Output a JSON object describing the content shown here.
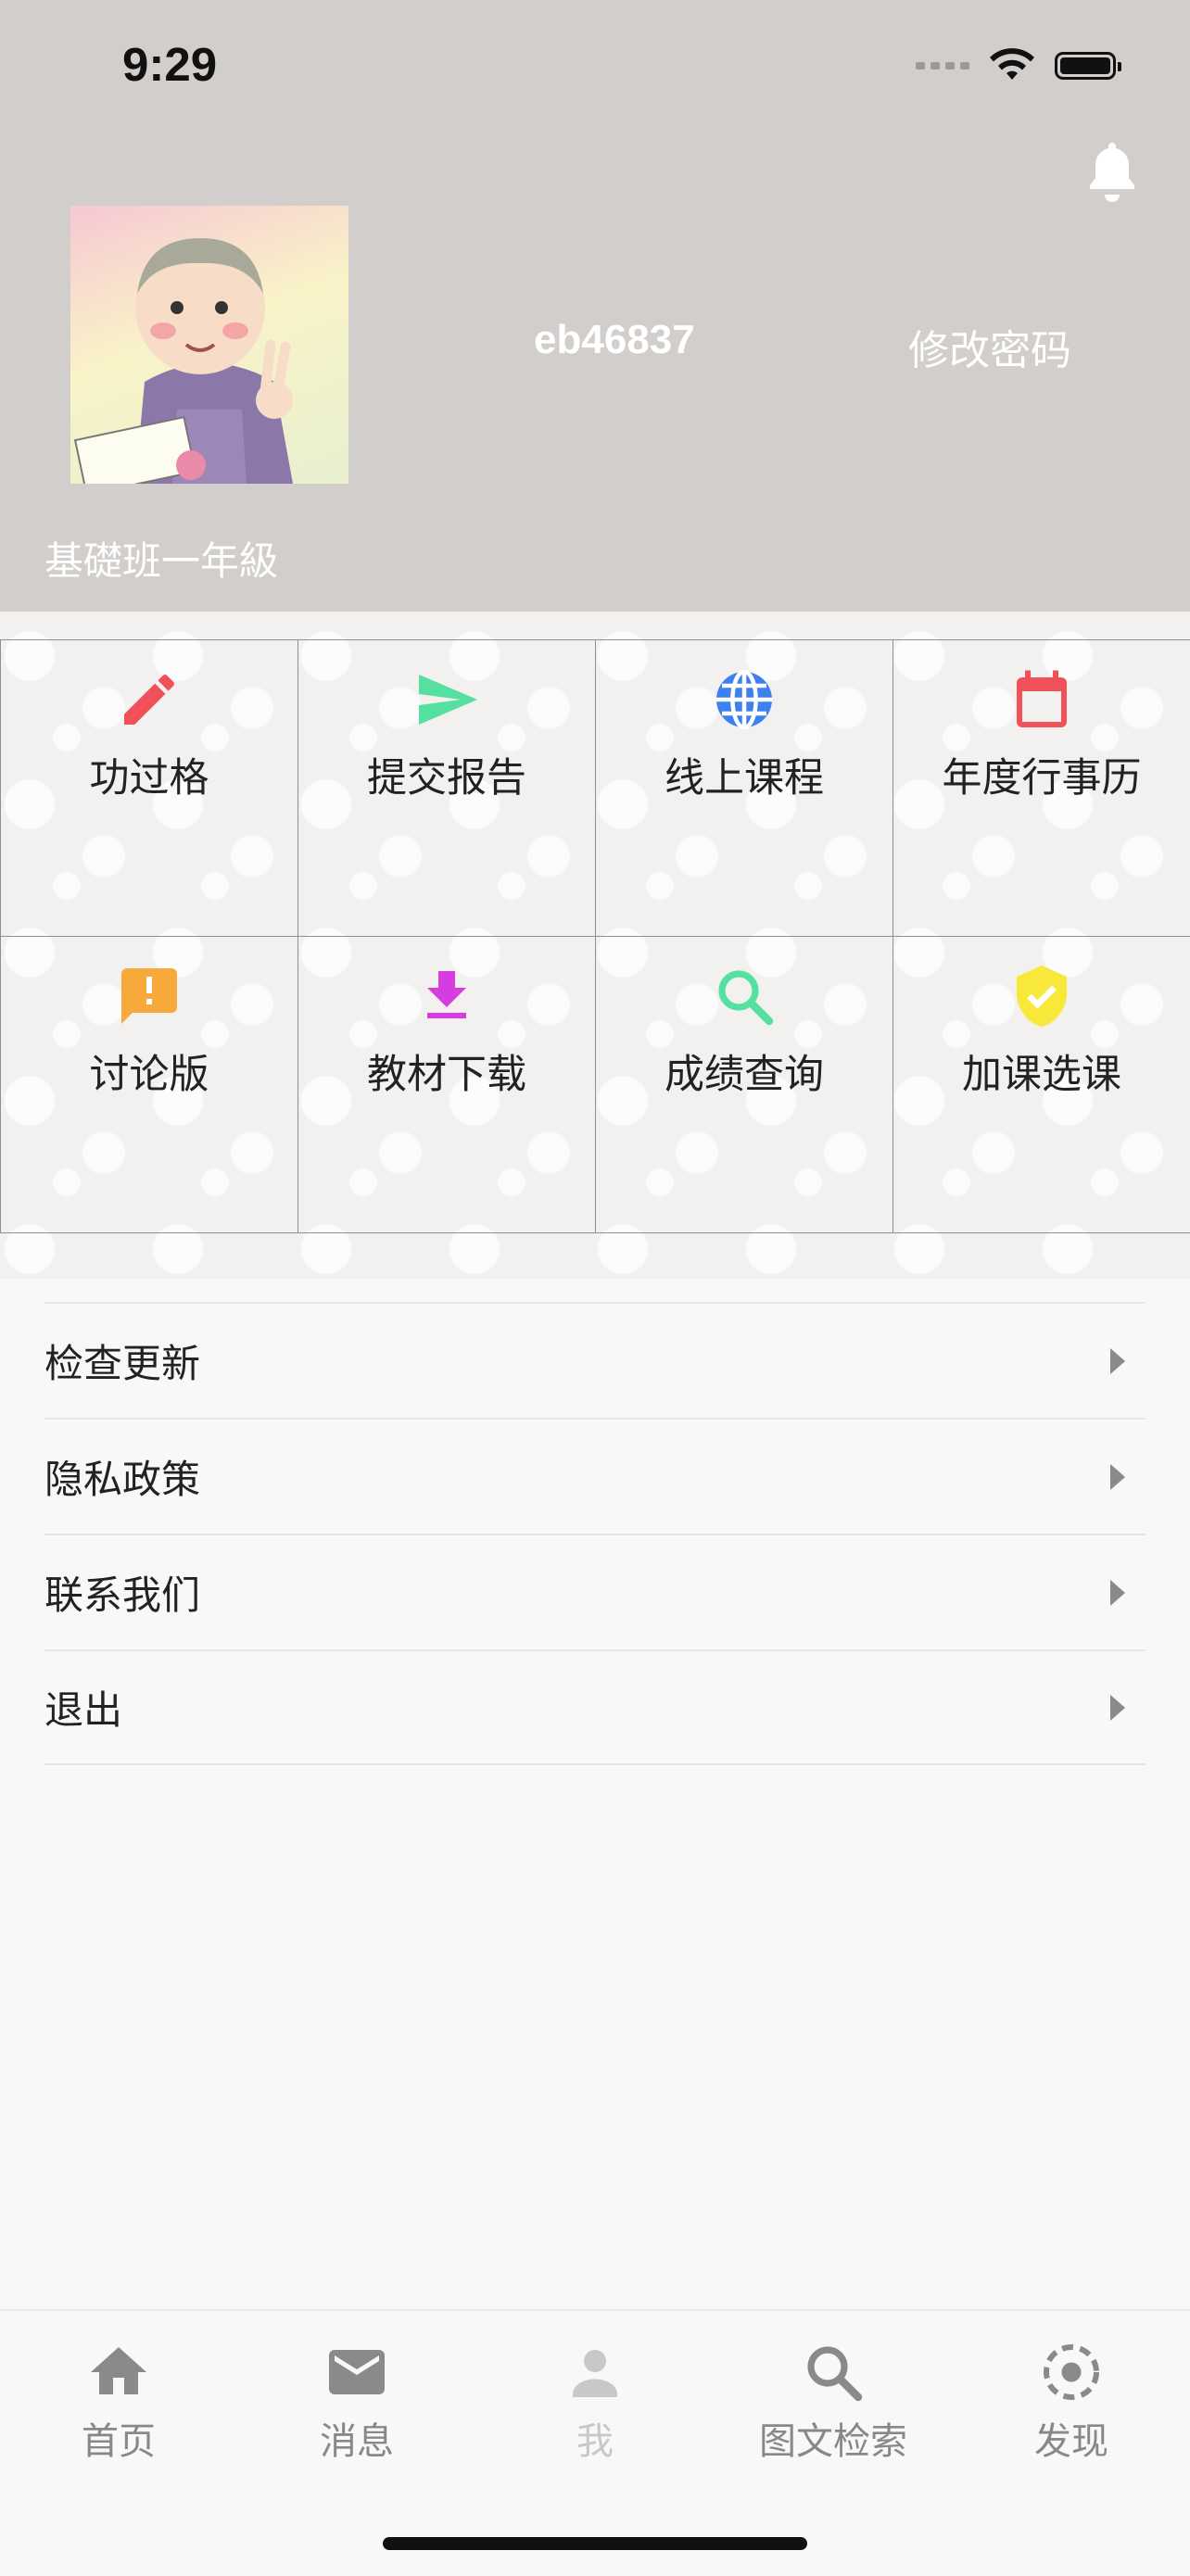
{
  "status_bar": {
    "time": "9:29"
  },
  "profile": {
    "username": "eb46837",
    "change_password_label": "修改密码",
    "class_label": "基礎班一年級"
  },
  "grid": [
    {
      "label": "功过格",
      "icon": "pencil-icon",
      "color": "#f0505a"
    },
    {
      "label": "提交报告",
      "icon": "send-icon",
      "color": "#55e0a0"
    },
    {
      "label": "线上课程",
      "icon": "globe-icon",
      "color": "#3d80ef"
    },
    {
      "label": "年度行事历",
      "icon": "calendar-icon",
      "color": "#f0505a"
    },
    {
      "label": "讨论版",
      "icon": "feedback-icon",
      "color": "#f7a93a"
    },
    {
      "label": "教材下载",
      "icon": "download-icon",
      "color": "#d63ce0"
    },
    {
      "label": "成绩查询",
      "icon": "search-icon",
      "color": "#55e0a0"
    },
    {
      "label": "加课选课",
      "icon": "shield-check-icon",
      "color": "#f8e83a"
    }
  ],
  "menu": [
    {
      "label": "检查更新"
    },
    {
      "label": "隐私政策"
    },
    {
      "label": "联系我们"
    },
    {
      "label": "退出"
    }
  ],
  "tabbar": [
    {
      "label": "首页",
      "icon": "home-icon"
    },
    {
      "label": "消息",
      "icon": "mail-icon"
    },
    {
      "label": "我",
      "icon": "person-icon",
      "active": true
    },
    {
      "label": "图文检索",
      "icon": "search-icon"
    },
    {
      "label": "发现",
      "icon": "discover-icon"
    }
  ]
}
